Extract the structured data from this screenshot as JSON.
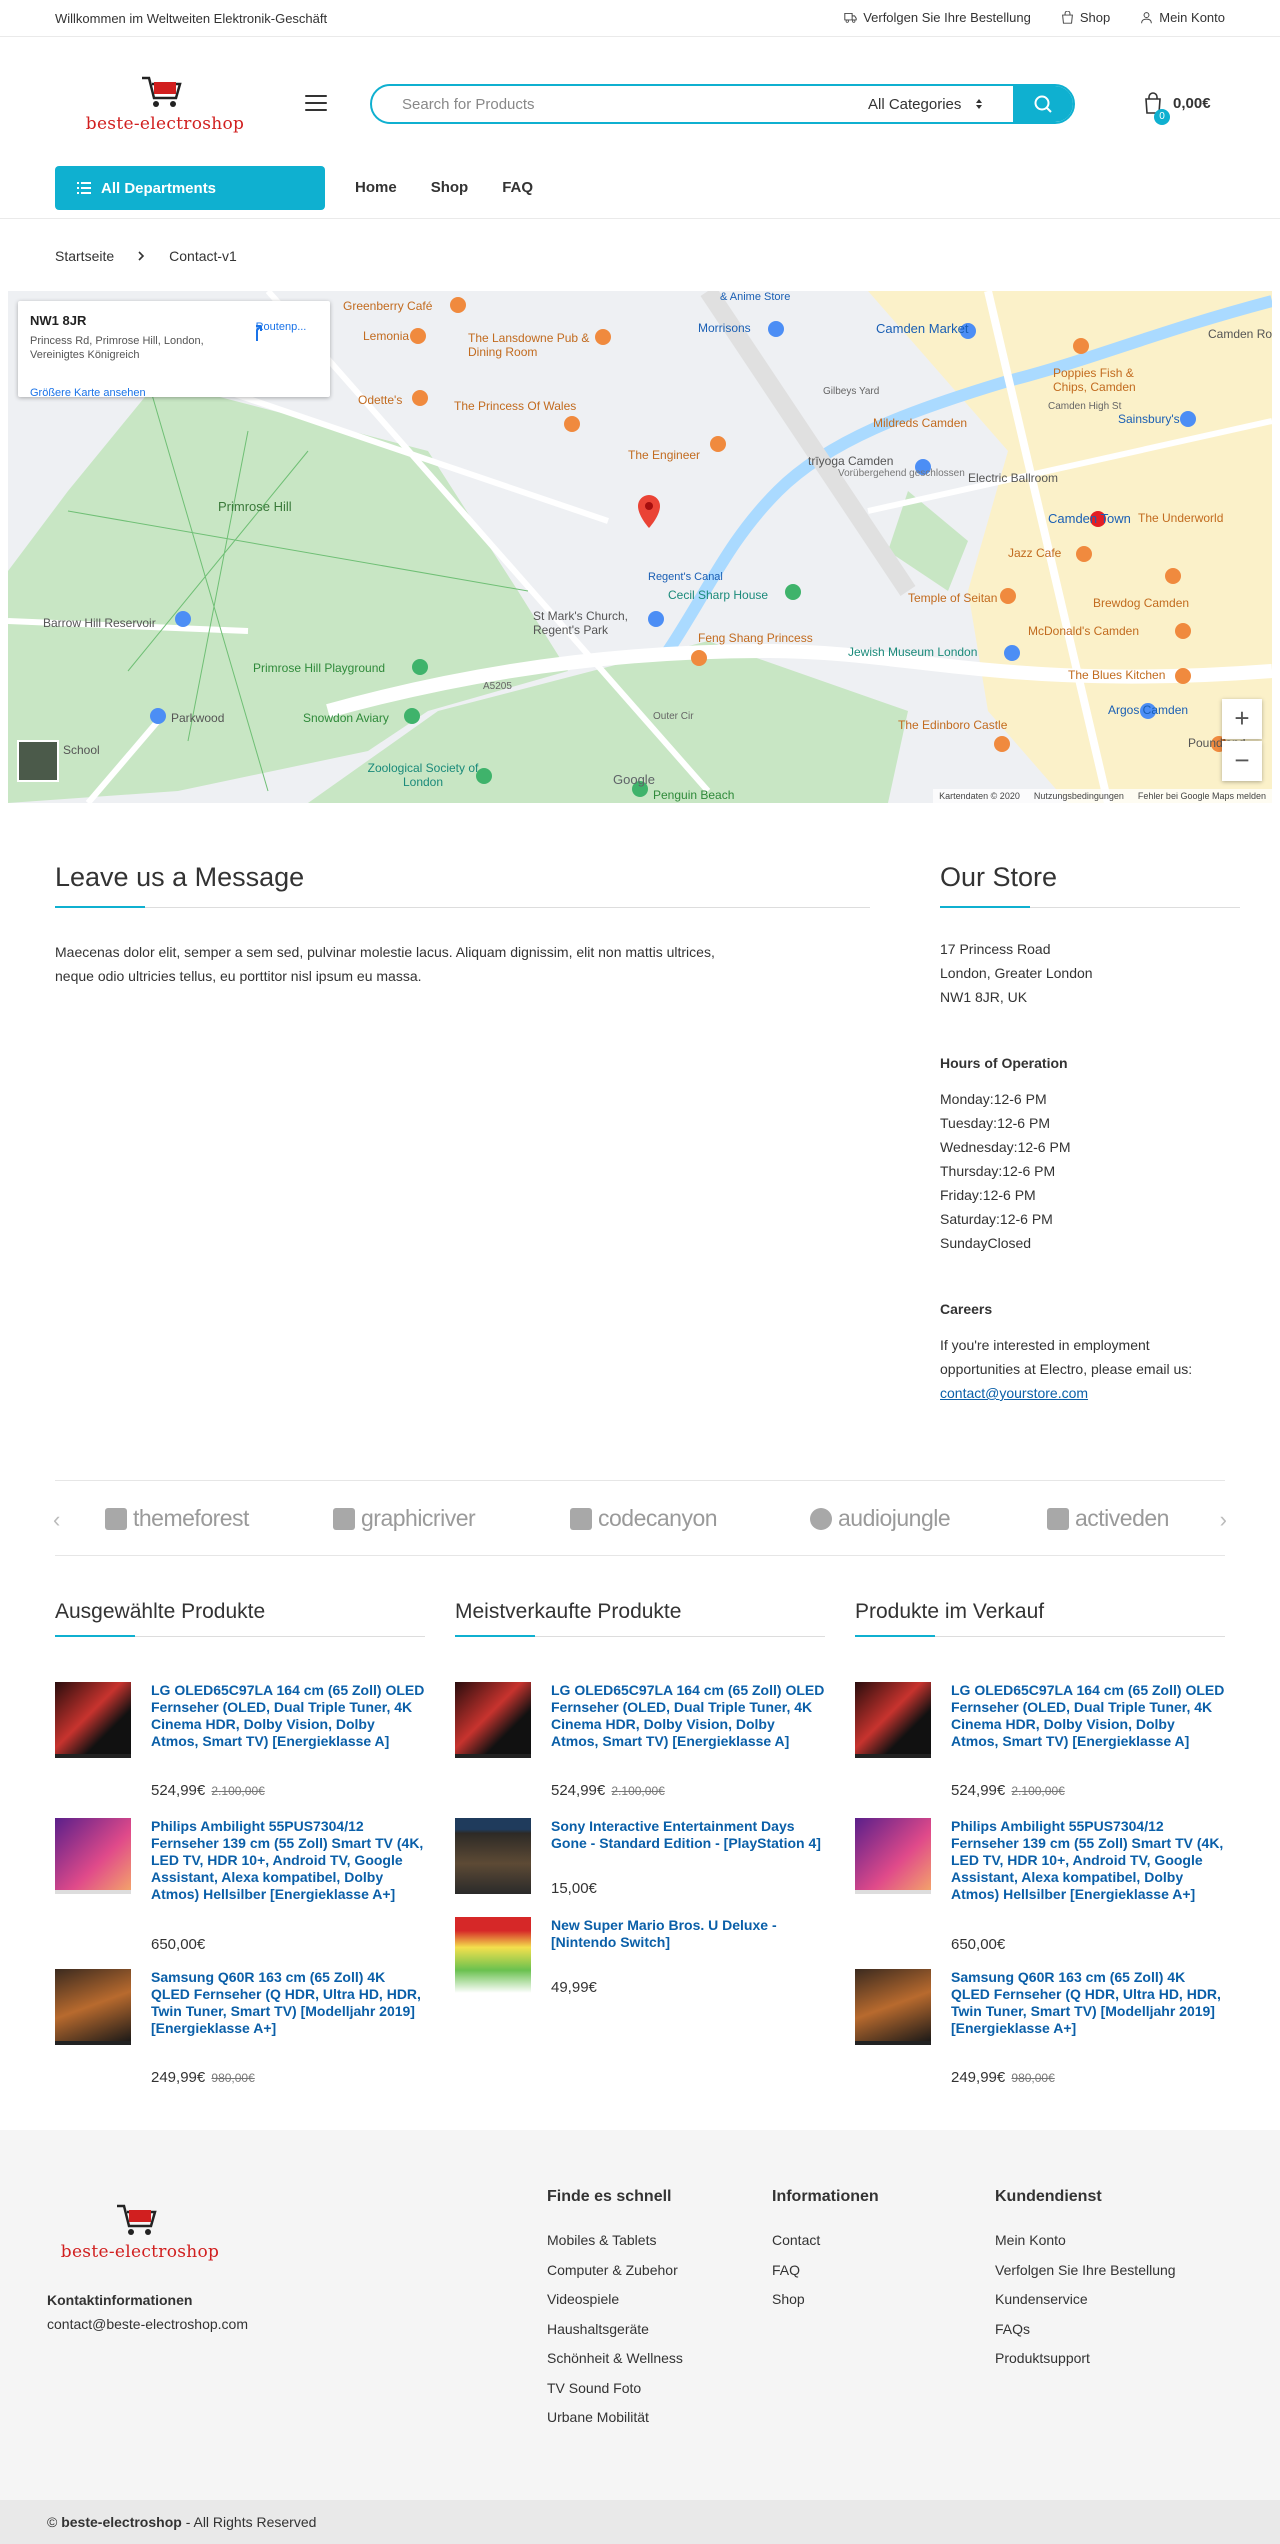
{
  "topbar": {
    "welcome": "Willkommen im Weltweiten Elektronik-Geschäft",
    "track_order": "Verfolgen Sie Ihre Bestellung",
    "shop": "Shop",
    "account": "Mein Konto"
  },
  "header": {
    "logo_text": "beste-electroshop",
    "search_placeholder": "Search for Products",
    "category_select": "All Categories",
    "cart_count": "0",
    "cart_total": "0,00€"
  },
  "nav": {
    "departments": "All Departments",
    "items": [
      "Home",
      "Shop",
      "FAQ"
    ]
  },
  "breadcrumb": [
    "Startseite",
    "Contact-v1"
  ],
  "map": {
    "card_title": "NW1 8JR",
    "card_address": "Princess Rd, Primrose Hill, London, Vereinigtes Königreich",
    "card_larger": "Größere Karte ansehen",
    "card_directions": "Routenp...",
    "labels": [
      "Primrose Hill",
      "Camden Market",
      "Camden Town",
      "The Engineer",
      "The Princess Of Wales",
      "The Lansdowne Pub & Dining Room",
      "Greenberry Café",
      "Lemonia",
      "Odette's",
      "Morrisons",
      "Camden Road",
      "Poppies Fish & Chips, Camden",
      "Sainsbury's",
      "Mildreds Camden",
      "Electric Ballroom",
      "trīyoga Camden",
      "Vorübergehend geschlossen",
      "The Underworld",
      "Jazz Cafe",
      "Temple of Seitan",
      "Brewdog Camden",
      "McDonald's Camden",
      "The Blues Kitchen",
      "Argos Camden",
      "Jewish Museum London",
      "Feng Shang Princess",
      "Cecil Sharp House",
      "Regent's Canal",
      "St Mark's Church, Regent's Park",
      "Primrose Hill Playground",
      "Snowdon Aviary",
      "Zoological Society of London",
      "Barrow Hill Reservoir",
      "Parkwood",
      "School",
      "Penguin Beach",
      "The Edinboro Castle",
      "Poundland",
      "Outer Cir",
      "A5205",
      "Camden High St",
      "Gilbeys Yard",
      "& Anime Store",
      "Google"
    ],
    "footer": [
      "Kartendaten © 2020",
      "Nutzungsbedingungen",
      "Fehler bei Google Maps melden"
    ]
  },
  "message": {
    "title": "Leave us a Message",
    "body": "Maecenas dolor elit, semper a sem sed, pulvinar molestie lacus. Aliquam dignissim, elit non mattis ultrices, neque odio ultricies tellus, eu porttitor nisl ipsum eu massa."
  },
  "store": {
    "title": "Our Store",
    "address": [
      "17 Princess Road",
      "London, Greater London",
      "NW1 8JR, UK"
    ],
    "hours_title": "Hours of Operation",
    "hours": [
      "Monday:12-6 PM",
      "Tuesday:12-6 PM",
      "Wednesday:12-6 PM",
      "Thursday:12-6 PM",
      "Friday:12-6 PM",
      "Saturday:12-6 PM",
      "SundayClosed"
    ],
    "careers_title": "Careers",
    "careers_text": "If you're interested in employment opportunities at Electro, please email us:",
    "careers_email": "contact@yourstore.com"
  },
  "brands": [
    "themeforest",
    "graphicriver",
    "codecanyon",
    "audiojungle",
    "activeden"
  ],
  "product_columns": [
    {
      "title": "Ausgewählte Produkte",
      "products": [
        {
          "name": "LG OLED65C97LA 164 cm (65 Zoll) OLED Fernseher (OLED, Dual Triple Tuner, 4K Cinema HDR, Dolby Vision, Dolby Atmos, Smart TV) [Energieklasse A]",
          "price": "524,99€",
          "old_price": "2.100,00€"
        },
        {
          "name": "Philips Ambilight 55PUS7304/12 Fernseher 139 cm (55 Zoll) Smart TV (4K, LED TV, HDR 10+, Android TV, Google Assistant, Alexa kompatibel, Dolby Atmos) Hellsilber [Energieklasse A+]",
          "price": "650,00€",
          "old_price": ""
        },
        {
          "name": "Samsung Q60R 163 cm (65 Zoll) 4K QLED Fernseher (Q HDR, Ultra HD, HDR, Twin Tuner, Smart TV) [Modelljahr 2019] [Energieklasse A+]",
          "price": "249,99€",
          "old_price": "980,00€"
        }
      ]
    },
    {
      "title": "Meistverkaufte Produkte",
      "products": [
        {
          "name": "LG OLED65C97LA 164 cm (65 Zoll) OLED Fernseher (OLED, Dual Triple Tuner, 4K Cinema HDR, Dolby Vision, Dolby Atmos, Smart TV) [Energieklasse A]",
          "price": "524,99€",
          "old_price": "2.100,00€"
        },
        {
          "name": "Sony Interactive Entertainment Days Gone - Standard Edition - [PlayStation 4]",
          "price": "15,00€",
          "old_price": ""
        },
        {
          "name": "New Super Mario Bros. U Deluxe - [Nintendo Switch]",
          "price": "49,99€",
          "old_price": ""
        }
      ]
    },
    {
      "title": "Produkte im Verkauf",
      "products": [
        {
          "name": "LG OLED65C97LA 164 cm (65 Zoll) OLED Fernseher (OLED, Dual Triple Tuner, 4K Cinema HDR, Dolby Vision, Dolby Atmos, Smart TV) [Energieklasse A]",
          "price": "524,99€",
          "old_price": "2.100,00€"
        },
        {
          "name": "Philips Ambilight 55PUS7304/12 Fernseher 139 cm (55 Zoll) Smart TV (4K, LED TV, HDR 10+, Android TV, Google Assistant, Alexa kompatibel, Dolby Atmos) Hellsilber [Energieklasse A+]",
          "price": "650,00€",
          "old_price": ""
        },
        {
          "name": "Samsung Q60R 163 cm (65 Zoll) 4K QLED Fernseher (Q HDR, Ultra HD, HDR, Twin Tuner, Smart TV) [Modelljahr 2019] [Energieklasse A+]",
          "price": "249,99€",
          "old_price": "980,00€"
        }
      ]
    }
  ],
  "footer": {
    "logo_text": "beste-electroshop",
    "contact_title": "Kontaktinformationen",
    "contact_email": "contact@beste-electroshop.com",
    "columns": [
      {
        "title": "Finde es schnell",
        "items": [
          "Mobiles & Tablets",
          "Computer & Zubehor",
          "Videospiele",
          "Haushaltsgeräte",
          "Schönheit & Wellness",
          "TV Sound Foto",
          "Urbane Mobilität"
        ]
      },
      {
        "title": "Informationen",
        "items": [
          "Contact",
          "FAQ",
          "Shop"
        ]
      },
      {
        "title": "Kundendienst",
        "items": [
          "Mein Konto",
          "Verfolgen Sie Ihre Bestellung",
          "Kundenservice",
          "FAQs",
          "Produktsupport"
        ]
      }
    ],
    "copyright_prefix": "© ",
    "copyright_brand": "beste-electroshop",
    "copyright_suffix": " - All Rights Reserved"
  },
  "colors": {
    "accent": "#0fb0d0",
    "link": "#0a5fa8",
    "logo_red": "#d11f1f"
  }
}
